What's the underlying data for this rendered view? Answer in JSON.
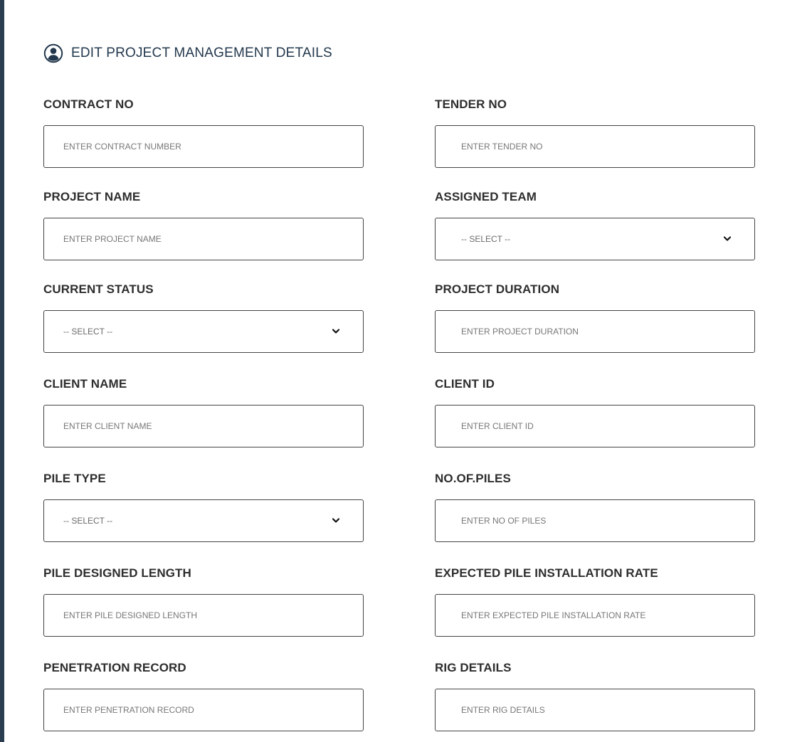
{
  "header": {
    "title": "EDIT PROJECT MANAGEMENT DETAILS",
    "icon": "user-circle-icon"
  },
  "colors": {
    "sidebar": "#2b3e4f",
    "title": "#23384d",
    "label": "#2e2e2e",
    "border": "#444444",
    "placeholder": "#777777"
  },
  "form": {
    "contract_no": {
      "label": "CONTRACT NO",
      "placeholder": "ENTER CONTRACT NUMBER",
      "value": ""
    },
    "tender_no": {
      "label": "TENDER NO",
      "placeholder": "ENTER TENDER NO",
      "value": ""
    },
    "project_name": {
      "label": "PROJECT NAME",
      "placeholder": "ENTER PROJECT NAME",
      "value": ""
    },
    "assigned_team": {
      "label": "ASSIGNED TEAM",
      "selected": "-- SELECT --"
    },
    "current_status": {
      "label": "CURRENT STATUS",
      "selected": "-- SELECT --"
    },
    "project_duration": {
      "label": "PROJECT DURATION",
      "placeholder": "ENTER PROJECT DURATION",
      "value": ""
    },
    "client_name": {
      "label": "CLIENT NAME",
      "placeholder": "ENTER CLIENT NAME",
      "value": ""
    },
    "client_id": {
      "label": "CLIENT ID",
      "placeholder": "ENTER CLIENT ID",
      "value": ""
    },
    "pile_type": {
      "label": "PILE TYPE",
      "selected": "-- SELECT --"
    },
    "no_of_piles": {
      "label": "NO.OF.PILES",
      "placeholder": "ENTER NO OF PILES",
      "value": ""
    },
    "pile_designed_length": {
      "label": "PILE DESIGNED LENGTH",
      "placeholder": "ENTER PILE DESIGNED LENGTH",
      "value": ""
    },
    "expected_pile_installation_rate": {
      "label": "EXPECTED PILE INSTALLATION RATE",
      "placeholder": "ENTER EXPECTED PILE INSTALLATION RATE",
      "value": ""
    },
    "penetration_record": {
      "label": "PENETRATION RECORD",
      "placeholder": "ENTER PENETRATION RECORD",
      "value": ""
    },
    "rig_details": {
      "label": "RIG DETAILS",
      "placeholder": "ENTER RIG DETAILS",
      "value": ""
    }
  }
}
